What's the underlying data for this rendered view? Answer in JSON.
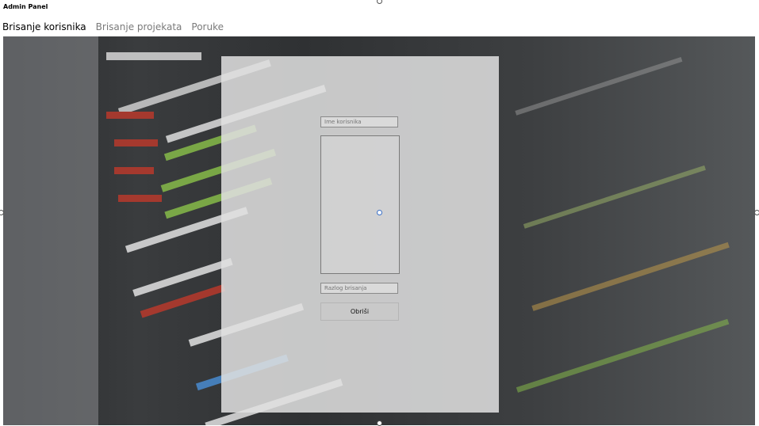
{
  "window": {
    "title": "Admin Panel"
  },
  "tabs": [
    {
      "label": "Brisanje korisnika",
      "active": true
    },
    {
      "label": "Brisanje projekata",
      "active": false
    },
    {
      "label": "Poruke",
      "active": false
    }
  ],
  "form": {
    "username_placeholder": "Ime korisnika",
    "reason_placeholder": "Razlog brisanja",
    "submit_label": "Obriši"
  },
  "background": {
    "description_icon": "code-editor-photo"
  },
  "colors": {
    "panel": "#e1e1e1",
    "button": "#c9c9c9",
    "active_tab": "#000000",
    "inactive_tab": "#7a7a7a"
  }
}
